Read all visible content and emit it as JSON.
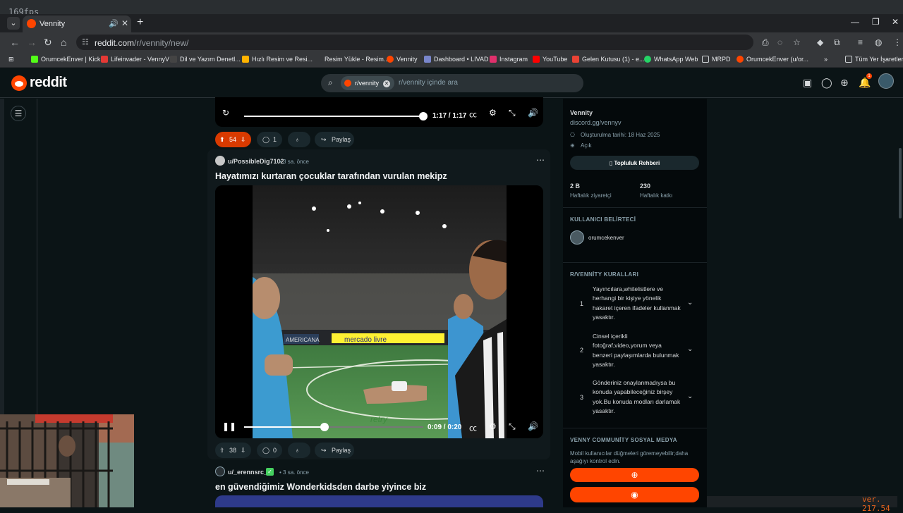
{
  "overlay": {
    "fps": "169fps",
    "version": "ver. 217.54"
  },
  "browser": {
    "tab_title": "Vennity",
    "url_host": "reddit.com",
    "url_path": "/r/vennity/new/",
    "bookmarks": [
      "OrumcekEnver | Kick",
      "Lifeinvader - VennyV",
      "Dil ve Yazım Denetl...",
      "Hızlı Resim ve Resi...",
      "Resim Yükle - Resim...",
      "Vennity",
      "Dashboard • LIVAD",
      "Instagram",
      "YouTube",
      "Gelen Kutusu (1) - e...",
      "WhatsApp Web",
      "MRPD",
      "OrumcekEnver (u/or...",
      "»",
      "Tüm Yer İşaretleri"
    ]
  },
  "reddit": {
    "logo_text": "reddit",
    "search_chip": "r/vennity",
    "search_placeholder": "r/vennity içinde ara",
    "notif_count": "1"
  },
  "feed": {
    "prev_post": {
      "time": "1:17 / 1:17",
      "progress": 1.0,
      "votes": "54",
      "comments": "1",
      "share": "Paylaş"
    },
    "post1": {
      "user": "u/PossibleDig7102",
      "time": "• 3 sa. önce",
      "title": "Hayatımızı kurtaran çocuklar tarafından vurulan mekipz",
      "video_time": "0:09 / 0:20",
      "progress": 0.45,
      "overlay_board_text": "mercado livre",
      "overlay_ad_text": "AMERICANA",
      "overlay_field_text": "retry",
      "votes": "38",
      "comments": "0",
      "share": "Paylaş"
    },
    "post2": {
      "user": "u/_erennsrc_",
      "time": "• 3 sa. önce",
      "title": "en güvendiğimiz Wonderkidsden darbe yiyince biz"
    }
  },
  "sidebar": {
    "name": "Vennity",
    "desc": "discord.gg/vennyv",
    "created": "Oluşturulma tarihi: 18 Haz 2025",
    "visibility": "Açık",
    "guide_button": "Topluluk Rehberi",
    "stats": [
      {
        "value": "2 B",
        "label": "Haftalık ziyaretçi"
      },
      {
        "value": "230",
        "label": "Haftalık katkı"
      }
    ],
    "flair_heading": "KULLANICI BELİRTECİ",
    "flair_user": "orumcekenver",
    "rules_heading": "R/VENNİTY KURALLARI",
    "rules": [
      {
        "n": "1",
        "text": "Yayıncılara,whitelistlere ve herhangi bir kişiye yönelik hakaret içeren ifadeler kullanmak yasaktır."
      },
      {
        "n": "2",
        "text": "Cinsel içerikli fotoğraf,video,yorum veya benzeri paylaşımlarda bulunmak yasaktır."
      },
      {
        "n": "3",
        "text": "Gönderiniz onaylanmadıysa bu konuda yapabileceğiniz birşey yok.Bu konuda modları darlamak yasaktır."
      }
    ],
    "social_heading": "VENNY COMMUNİTY SOSYAL MEDYA",
    "social_desc": "Mobil kullanıcılar düğmeleri göremeyebilir;daha aşağıyı kontrol edin.",
    "colors": {
      "accent": "#ff4500",
      "bg": "#0b1416",
      "panel": "#04090b"
    }
  }
}
